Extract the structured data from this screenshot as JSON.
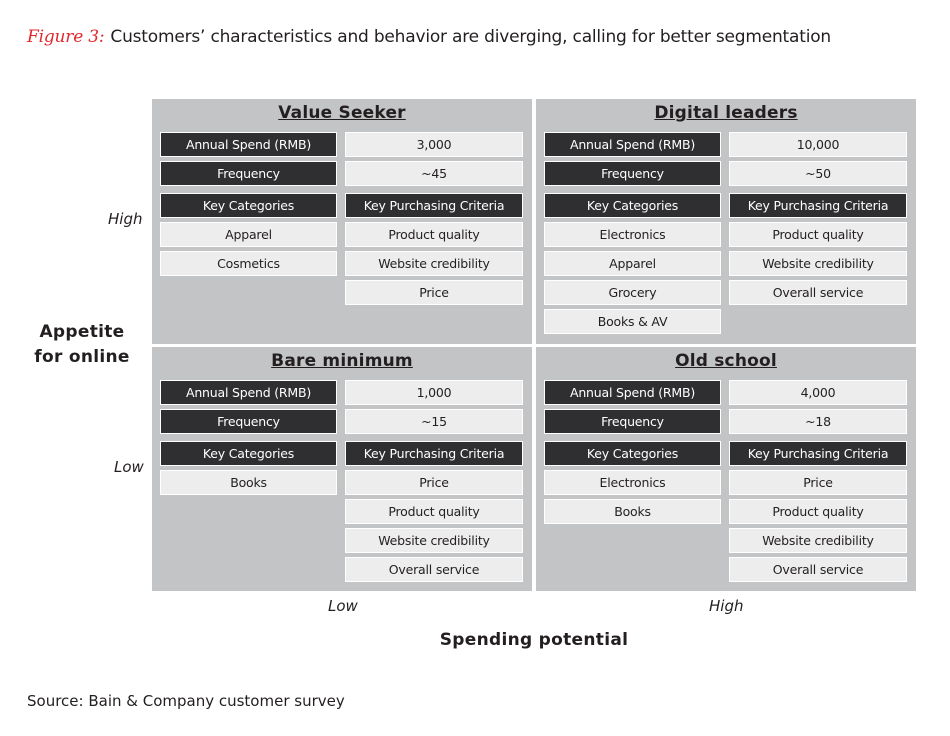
{
  "figure": {
    "label": "Figure 3:",
    "title": "Customers’ characteristics and behavior are diverging, calling for better segmentation"
  },
  "axes": {
    "y_title_line1": "Appetite",
    "y_title_line2": "for online",
    "y_high": "High",
    "y_low": "Low",
    "x_title": "Spending potential",
    "x_low": "Low",
    "x_high": "High"
  },
  "headers": {
    "annual_spend": "Annual Spend (RMB)",
    "frequency": "Frequency",
    "key_categories": "Key Categories",
    "key_purchasing_criteria": "Key Purchasing Criteria"
  },
  "segments": {
    "value_seeker": {
      "name": "Value Seeker",
      "position": "high appetite, low spending",
      "annual_spend": "3,000",
      "frequency": "~45",
      "categories": [
        "Apparel",
        "Cosmetics"
      ],
      "criteria": [
        "Product quality",
        "Website credibility",
        "Price"
      ]
    },
    "digital_leaders": {
      "name": "Digital leaders",
      "position": "high appetite, high spending",
      "annual_spend": "10,000",
      "frequency": "~50",
      "categories": [
        "Electronics",
        "Apparel",
        "Grocery",
        "Books & AV"
      ],
      "criteria": [
        "Product quality",
        "Website credibility",
        "Overall service"
      ]
    },
    "bare_minimum": {
      "name": "Bare minimum",
      "position": "low appetite, low spending",
      "annual_spend": "1,000",
      "frequency": "~15",
      "categories": [
        "Books"
      ],
      "criteria": [
        "Price",
        "Product quality",
        "Website credibility",
        "Overall service"
      ]
    },
    "old_school": {
      "name": "Old school",
      "position": "low appetite, high spending",
      "annual_spend": "4,000",
      "frequency": "~18",
      "categories": [
        "Electronics",
        "Books"
      ],
      "criteria": [
        "Price",
        "Product quality",
        "Website credibility",
        "Overall service"
      ]
    }
  },
  "colors": {
    "figure_label": "#e0282e",
    "quadrant_bg": "#c3c4c6",
    "header_cell": "#2f2f32",
    "value_cell": "#ededed"
  },
  "source": "Source: Bain & Company customer survey"
}
